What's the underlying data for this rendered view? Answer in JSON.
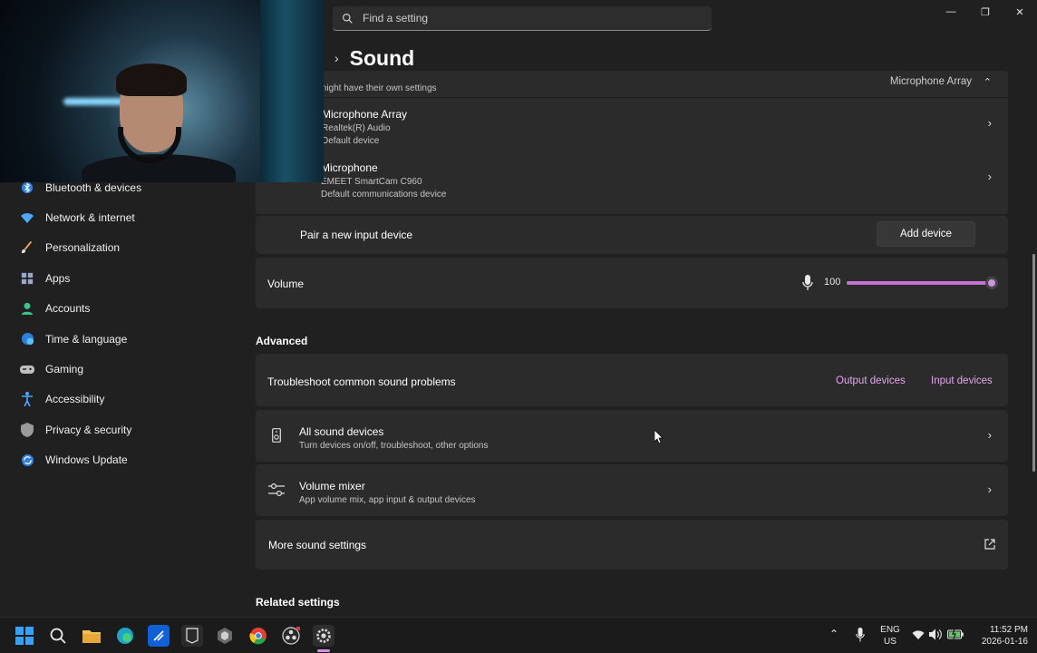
{
  "window": {
    "search_placeholder": "Find a setting",
    "page_title": "Sound",
    "controls": {
      "minimize": "—",
      "maximize": "❐",
      "close": "✕"
    }
  },
  "sidebar": {
    "items": [
      {
        "label": "Bluetooth & devices",
        "icon": "bluetooth-icon",
        "color": "#4fa8ff"
      },
      {
        "label": "Network & internet",
        "icon": "wifi-icon",
        "color": "#4fa8ff"
      },
      {
        "label": "Personalization",
        "icon": "brush-icon",
        "color": "#f0a35a"
      },
      {
        "label": "Apps",
        "icon": "apps-icon",
        "color": "#9aa8c8"
      },
      {
        "label": "Accounts",
        "icon": "person-icon",
        "color": "#3cc48a"
      },
      {
        "label": "Time & language",
        "icon": "globe-clock-icon",
        "color": "#4fa8ff"
      },
      {
        "label": "Gaming",
        "icon": "controller-icon",
        "color": "#bfbfbf"
      },
      {
        "label": "Accessibility",
        "icon": "accessibility-icon",
        "color": "#4fa8ff"
      },
      {
        "label": "Privacy & security",
        "icon": "shield-icon",
        "color": "#9a9a9a"
      },
      {
        "label": "Windows Update",
        "icon": "update-icon",
        "color": "#4fa8ff"
      }
    ]
  },
  "input": {
    "choose_device_sub": "might have their own settings",
    "selected_device": "Microphone Array",
    "devices": [
      {
        "name": "Microphone Array",
        "detail1": "Realtek(R) Audio",
        "detail2": "Default device"
      },
      {
        "name": "Microphone",
        "detail1": "EMEET SmartCam C960",
        "detail2": "Default communications device"
      }
    ],
    "pair_label": "Pair a new input device",
    "add_device_button": "Add device",
    "volume_label": "Volume",
    "volume_value": "100",
    "volume_fraction": 1.0
  },
  "advanced": {
    "heading": "Advanced",
    "troubleshoot_label": "Troubleshoot common sound problems",
    "output_devices_link": "Output devices",
    "input_devices_link": "Input devices",
    "all_sound_devices": {
      "title": "All sound devices",
      "sub": "Turn devices on/off, troubleshoot, other options"
    },
    "volume_mixer": {
      "title": "Volume mixer",
      "sub": "App volume mix, app input & output devices"
    },
    "more_sound_settings": "More sound settings",
    "related_heading": "Related settings"
  },
  "taskbar": {
    "lang_line1": "ENG",
    "lang_line2": "US",
    "time": "11:52 PM",
    "date": "2026-01-16"
  },
  "colors": {
    "accent": "#d38fe0",
    "card": "#2b2b2b",
    "background": "#202020"
  }
}
